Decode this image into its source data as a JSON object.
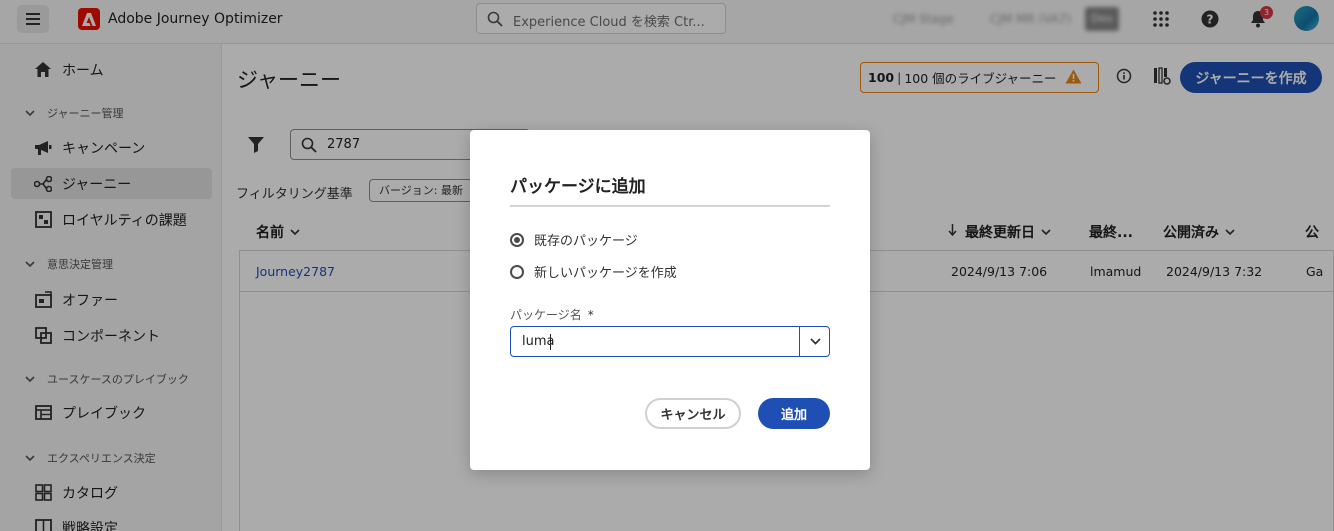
{
  "topbar": {
    "app_title": "Adobe Journey Optimizer",
    "search_placeholder": "Experience Cloud を検索 Ctr...",
    "org_stage": "CJM Stage",
    "org_name": "CJM MR (VA7)",
    "sandbox": "Dev",
    "notification_count": "3"
  },
  "sidebar": {
    "home": "ホーム",
    "group_journey": "ジャーニー管理",
    "campaign": "キャンペーン",
    "journey": "ジャーニー",
    "loyalty": "ロイヤルティの課題",
    "group_decision": "意思決定管理",
    "offer": "オファー",
    "component": "コンポーネント",
    "group_playbook": "ユースケースのプレイブック",
    "playbook": "プレイブック",
    "group_experience": "エクスペリエンス決定",
    "catalog": "カタログ",
    "strategy": "戦略設定"
  },
  "main": {
    "title": "ジャーニー",
    "live_count": "100",
    "live_text": "100 個のライブジャーニー",
    "create_button": "ジャーニーを作成",
    "search_value": "2787",
    "filter_label": "フィルタリング基準",
    "filter_chip": "バージョン: 最新",
    "columns": {
      "name": "名前",
      "last_updated": "最終更新日",
      "last_by": "最終...",
      "published": "公開済み",
      "pub_by": "公"
    },
    "row": {
      "name": "Journey2787",
      "last_updated": "2024/9/13 7:06",
      "last_by": "lmamud",
      "published": "2024/9/13 7:32",
      "pub_by": "Ga"
    }
  },
  "modal": {
    "title": "パッケージに追加",
    "option_existing": "既存のパッケージ",
    "option_new": "新しいパッケージを作成",
    "field_label": "パッケージ名",
    "required_mark": "*",
    "field_value": "luma",
    "cancel_button": "キャンセル",
    "add_button": "追加"
  },
  "colors": {
    "accent": "#1f4fb4",
    "warning": "#e68619",
    "badge": "#d7373f",
    "adobe_red": "#eb1000"
  }
}
